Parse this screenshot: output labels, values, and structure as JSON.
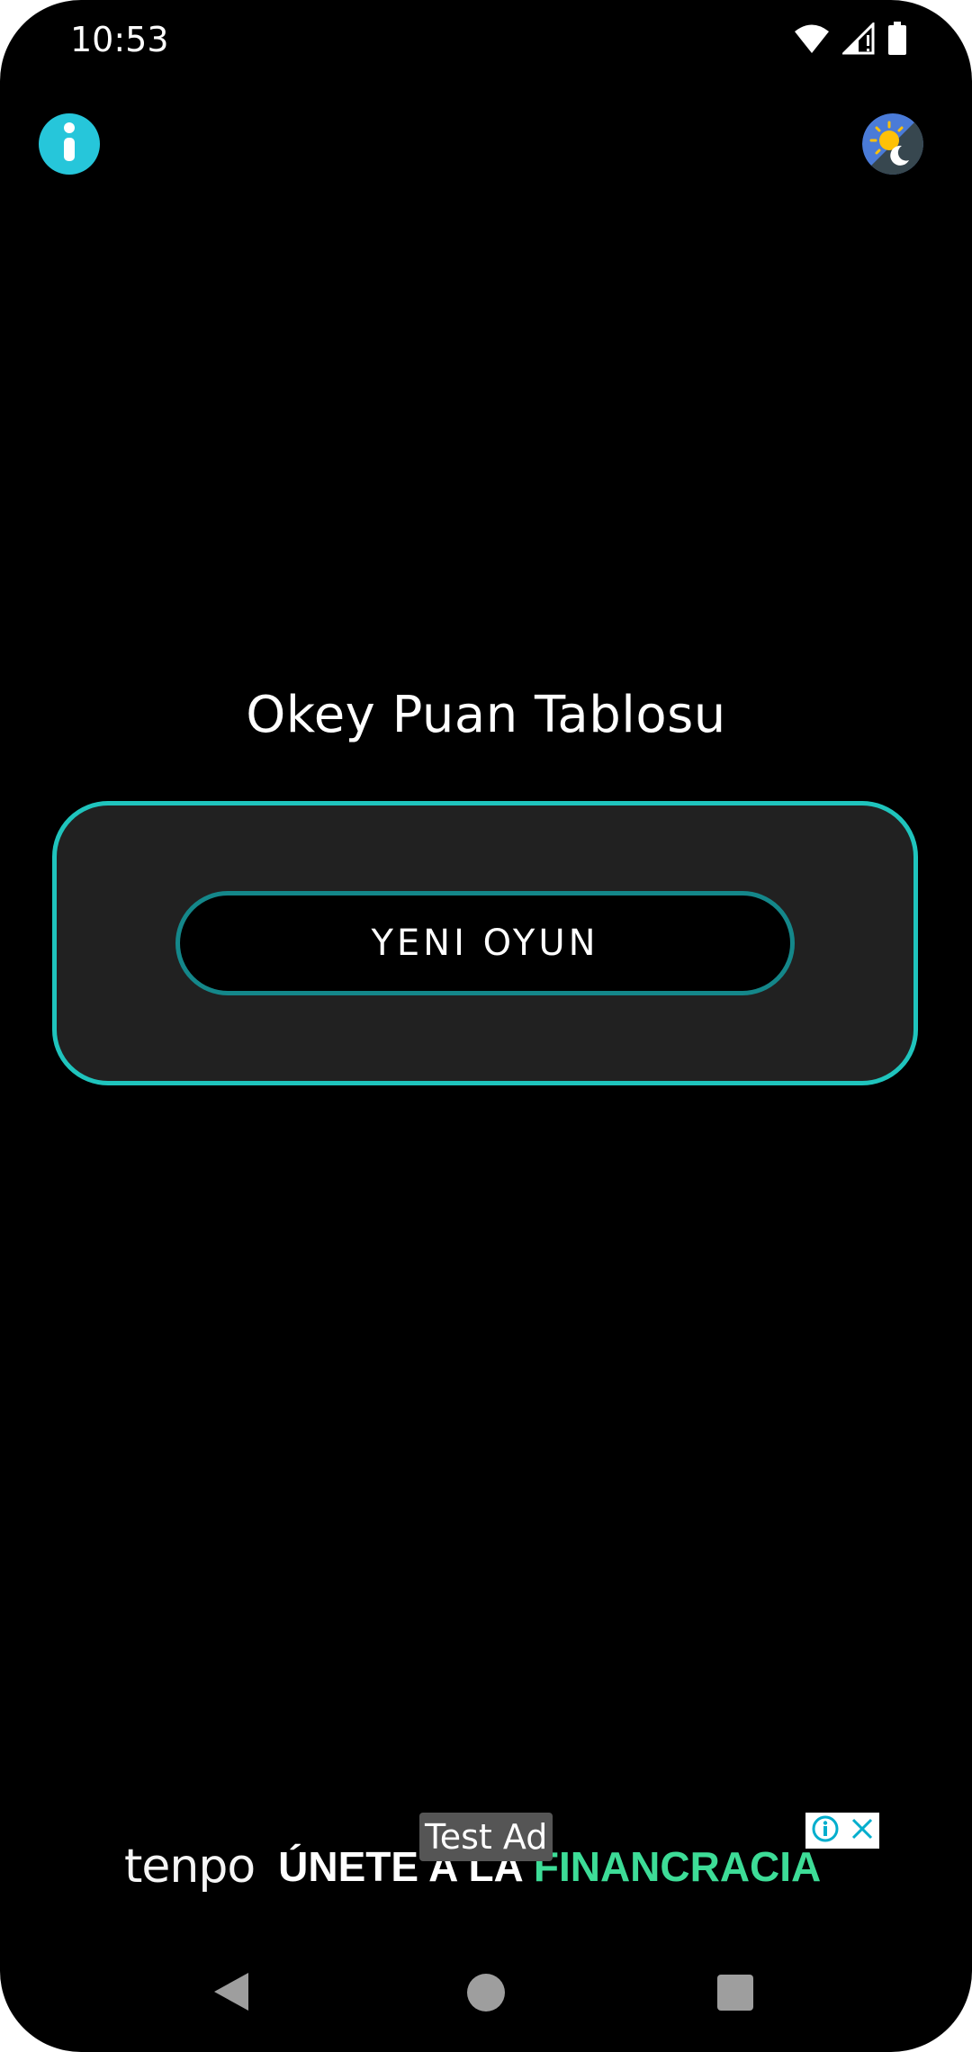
{
  "status_bar": {
    "time": "10:53",
    "icons": [
      "wifi-icon",
      "cell-signal-icon",
      "battery-icon"
    ]
  },
  "top_bar": {
    "info_icon": "info-icon",
    "theme_icon": "day-night-icon"
  },
  "main": {
    "title": "Okey Puan Tablosu",
    "new_game_label": "YENI OYUN"
  },
  "ad": {
    "test_label": "Test Ad",
    "brand": "tenpo",
    "headline_prefix": "ÚNETE A LA",
    "headline_accent": "FINANCRACIA"
  },
  "nav_bar": {
    "icons": [
      "back-icon",
      "home-icon",
      "recents-icon"
    ]
  },
  "colors": {
    "background": "#000000",
    "accent_teal": "#1fc4bd",
    "button_border": "#14878a",
    "card_fill": "#212121",
    "info_button": "#26c6da",
    "ad_accent": "#3ddc97"
  }
}
